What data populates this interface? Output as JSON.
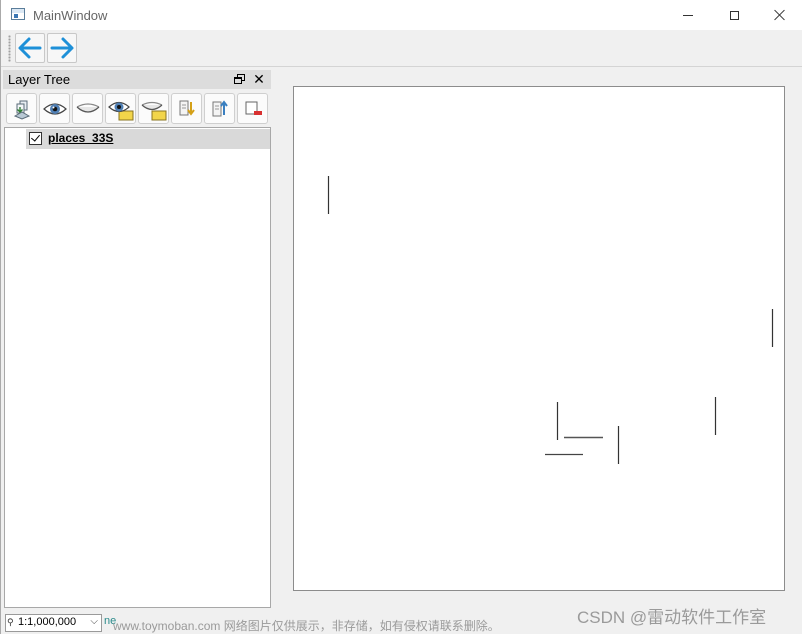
{
  "window": {
    "title": "MainWindow"
  },
  "toolbar": {
    "back_icon": "arrow-left-icon",
    "forward_icon": "arrow-right-icon",
    "accent": "#1e90d8"
  },
  "layer_tree": {
    "title": "Layer Tree",
    "float_icon": "dock-float-icon",
    "close_glyph": "✕",
    "buttons": [
      {
        "name": "add-group-button",
        "icon": "add-group-icon"
      },
      {
        "name": "show-all-button",
        "icon": "eye-icon"
      },
      {
        "name": "hide-all-button",
        "icon": "eye-closed-icon"
      },
      {
        "name": "show-selected-button",
        "icon": "eye-layer-icon"
      },
      {
        "name": "hide-selected-button",
        "icon": "eye-closed-layer-icon"
      },
      {
        "name": "expand-all-button",
        "icon": "expand-icon"
      },
      {
        "name": "collapse-all-button",
        "icon": "collapse-icon"
      },
      {
        "name": "remove-layer-button",
        "icon": "remove-layer-icon"
      }
    ],
    "layers": [
      {
        "name": "places_33S",
        "checked": true
      }
    ]
  },
  "statusbar": {
    "scale": "1:1,000,000",
    "scale_dropdown_glyph": "⌵",
    "message": "ne"
  },
  "watermark": {
    "left": "www.toymoban.com 网络图片仅供展示，非存储，如有侵权请联系删除。",
    "right": "CSDN @雷动软件工作室"
  }
}
